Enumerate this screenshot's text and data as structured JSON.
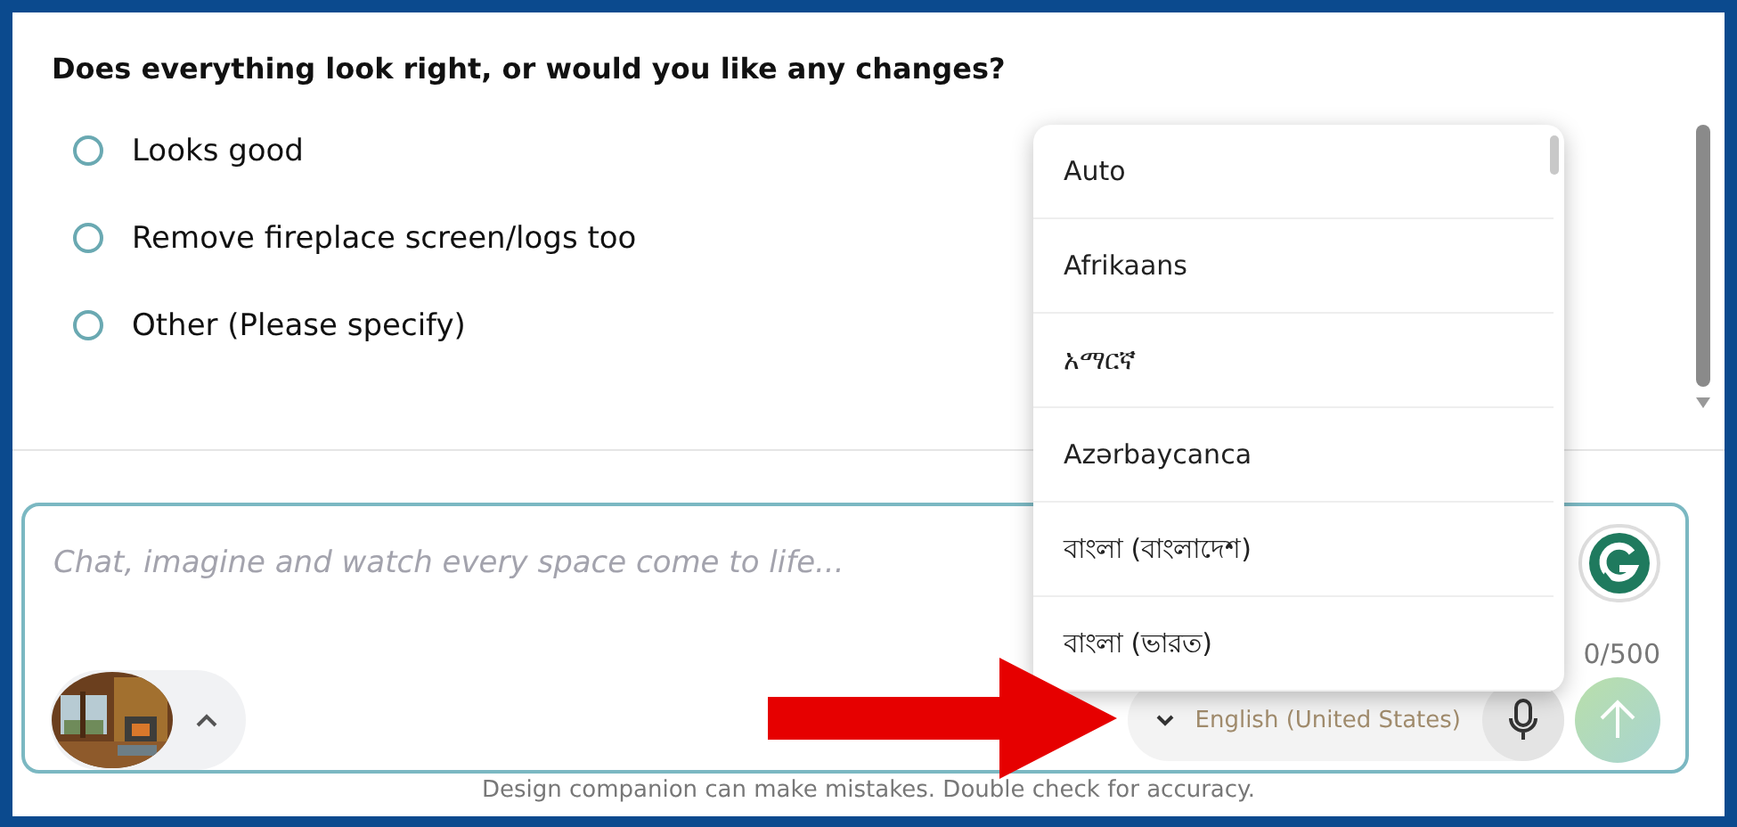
{
  "question": "Does everything look right, or would you like any changes?",
  "options": [
    {
      "label": "Looks good",
      "selected": false
    },
    {
      "label": "Remove fireplace screen/logs too",
      "selected": false
    },
    {
      "label": "Other (Please specify)",
      "selected": false
    }
  ],
  "composer": {
    "placeholder": "Chat, imagine and watch every space come to life...",
    "counter": "0/500",
    "language": "English (United States)"
  },
  "language_menu": [
    "Auto",
    "Afrikaans",
    "አማርኛ",
    "Azərbaycanca",
    "বাংলা (বাংলাদেশ)",
    "বাংলা (ভারত)"
  ],
  "footer": "Design companion can make mistakes. Double check for accuracy."
}
